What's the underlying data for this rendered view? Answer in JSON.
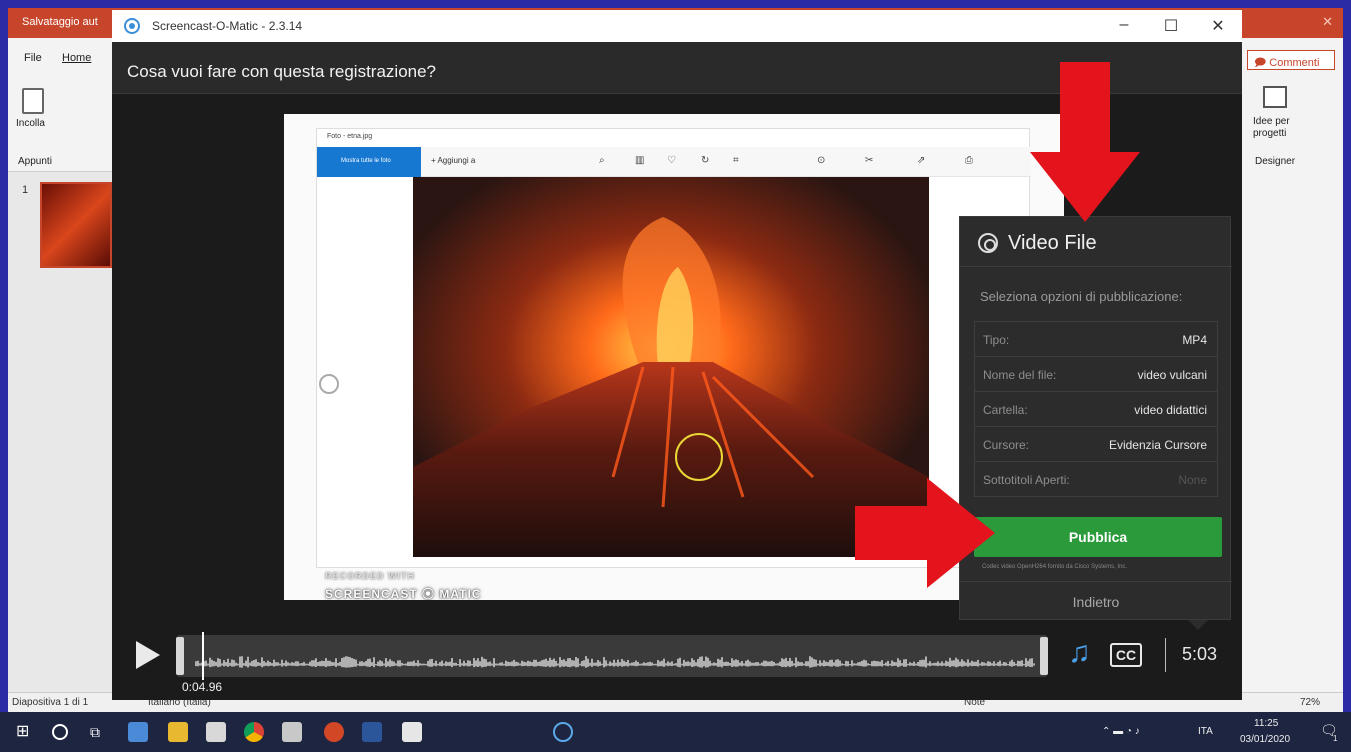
{
  "powerpoint": {
    "title_partial": "Salvataggio aut",
    "menu": {
      "file": "File",
      "home": "Home"
    },
    "ribbon": {
      "paste": "Incolla",
      "clipboard_group": "Appunti"
    },
    "right_ribbon": {
      "comments": "Commenti",
      "design_ideas": "Idee per progetti",
      "designer_group": "Designer"
    },
    "slide_number": "1",
    "status": {
      "slide_info": "Diapositiva 1 di 1",
      "language": "Italiano (Italia)",
      "notes": "Note",
      "zoom": "72%"
    }
  },
  "screencast": {
    "window_title": "Screencast-O-Matic - 2.3.14",
    "window_controls": {
      "minimize": "–",
      "maximize": "☐",
      "close": "✕"
    },
    "question": "Cosa vuoi fare con questa registrazione?",
    "preview": {
      "photo_app_title": "Foto - etna.jpg",
      "photo_app_primary_button": "Mostra tutte le foto",
      "photo_app_add": "+ Aggiungi a",
      "watermark_small": "RECORDED WITH",
      "watermark_brand": "SCREENCAST ⦿ MATIC"
    },
    "panel": {
      "title": "Video File",
      "subtitle": "Seleziona opzioni di pubblicazione:",
      "options": [
        {
          "label": "Tipo:",
          "value": "MP4"
        },
        {
          "label": "Nome del file:",
          "value": "video vulcani"
        },
        {
          "label": "Cartella:",
          "value": "video didattici"
        },
        {
          "label": "Cursore:",
          "value": "Evidenzia Cursore"
        },
        {
          "label": "Sottotitoli Aperti:",
          "value": "None"
        }
      ],
      "publish_label": "Pubblica",
      "codec_note": "Codec video OpenH264 fornito da Cisco Systems, Inc.",
      "back_label": "Indietro"
    },
    "player": {
      "current_time": "0:04.96",
      "duration": "5:03",
      "cc_label": "CC"
    }
  },
  "taskbar": {
    "language": "ITA",
    "clock_time": "11:25",
    "clock_date": "03/01/2020",
    "notifications": "1"
  },
  "colors": {
    "frame": "#2b2ba6",
    "ppt_accent": "#c7452b",
    "publish": "#2a9a3b",
    "arrow": "#e3141c",
    "cursor_ring": "#e8d736"
  }
}
